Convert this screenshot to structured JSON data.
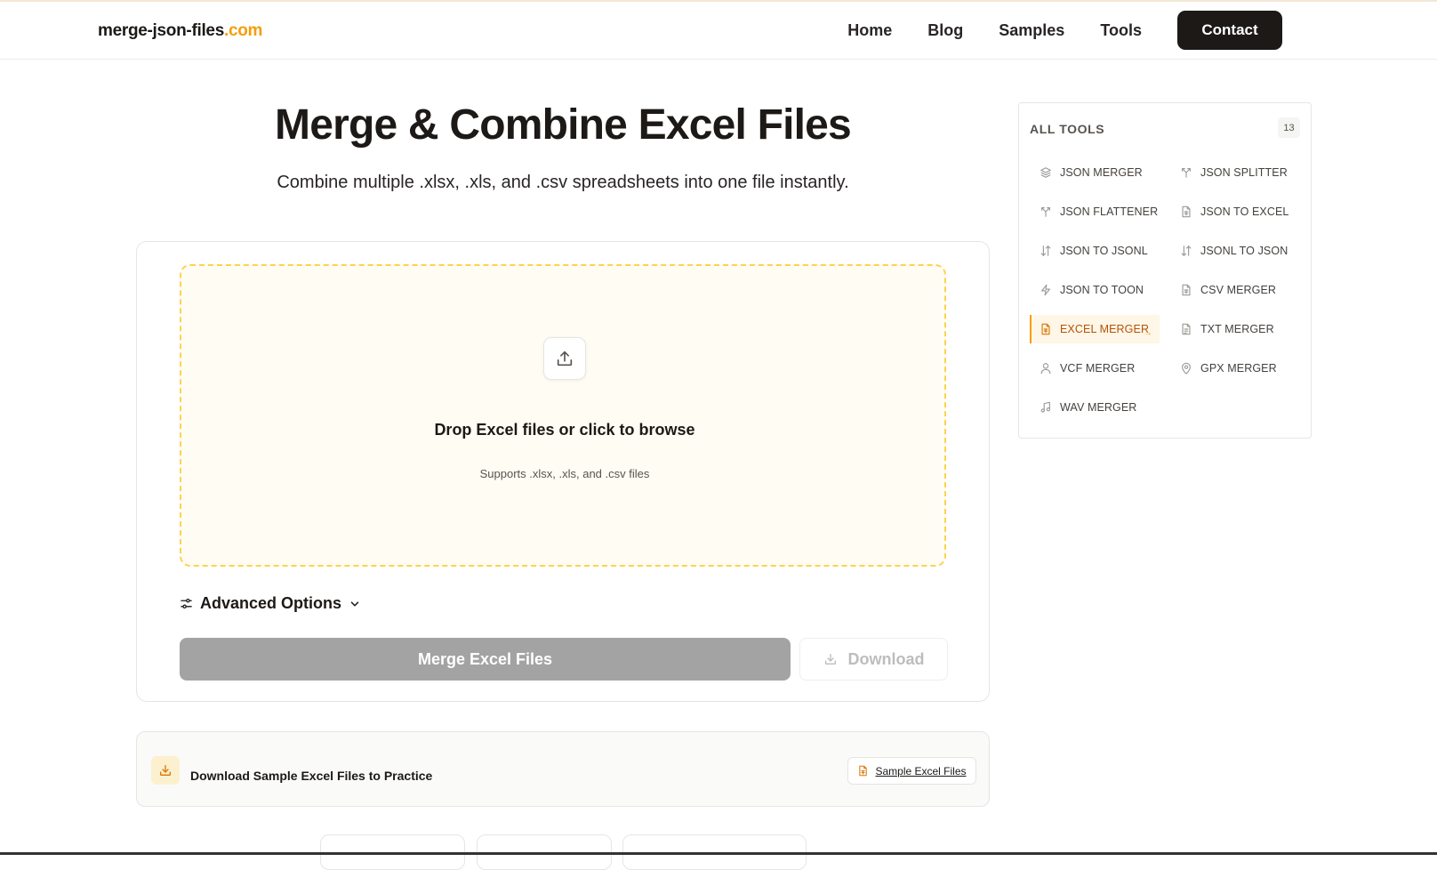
{
  "brand": {
    "name": "merge-json-files",
    "tld": ".com"
  },
  "nav": {
    "home": "Home",
    "blog": "Blog",
    "samples": "Samples",
    "tools": "Tools",
    "contact": "Contact"
  },
  "hero": {
    "title": "Merge & Combine Excel Files",
    "subtitle": "Combine multiple .xlsx, .xls, and .csv spreadsheets into one file instantly."
  },
  "dropzone": {
    "title": "Drop Excel files or click to browse",
    "subtitle": "Supports .xlsx, .xls, and .csv files"
  },
  "options": {
    "advanced_label": "Advanced Options"
  },
  "actions": {
    "merge_label": "Merge Excel Files",
    "download_label": "Download"
  },
  "samples": {
    "text": "Download Sample Excel Files to Practice",
    "link_label": "Sample Excel Files"
  },
  "sidebar": {
    "title": "ALL TOOLS",
    "count": "13",
    "tools": [
      {
        "label": "JSON MERGER",
        "icon": "layers-icon"
      },
      {
        "label": "JSON SPLITTER",
        "icon": "split-icon"
      },
      {
        "label": "JSON FLATTENER",
        "icon": "merge-icon"
      },
      {
        "label": "JSON TO EXCEL",
        "icon": "file-spreadsheet-icon"
      },
      {
        "label": "JSON TO JSONL",
        "icon": "arrows-up-down-icon"
      },
      {
        "label": "JSONL TO JSON",
        "icon": "arrows-up-down-icon"
      },
      {
        "label": "JSON TO TOON",
        "icon": "bolt-icon"
      },
      {
        "label": "CSV MERGER",
        "icon": "file-spreadsheet-icon"
      },
      {
        "label": "EXCEL MERGER",
        "icon": "file-spreadsheet-icon",
        "active": true
      },
      {
        "label": "TXT MERGER",
        "icon": "file-text-icon"
      },
      {
        "label": "VCF MERGER",
        "icon": "user-icon"
      },
      {
        "label": "GPX MERGER",
        "icon": "map-pin-icon"
      },
      {
        "label": "WAV MERGER",
        "icon": "music-icon"
      }
    ]
  },
  "colors": {
    "accent": "#f59e0b",
    "dark": "#1c1917",
    "disabled": "#a3a3a3"
  }
}
